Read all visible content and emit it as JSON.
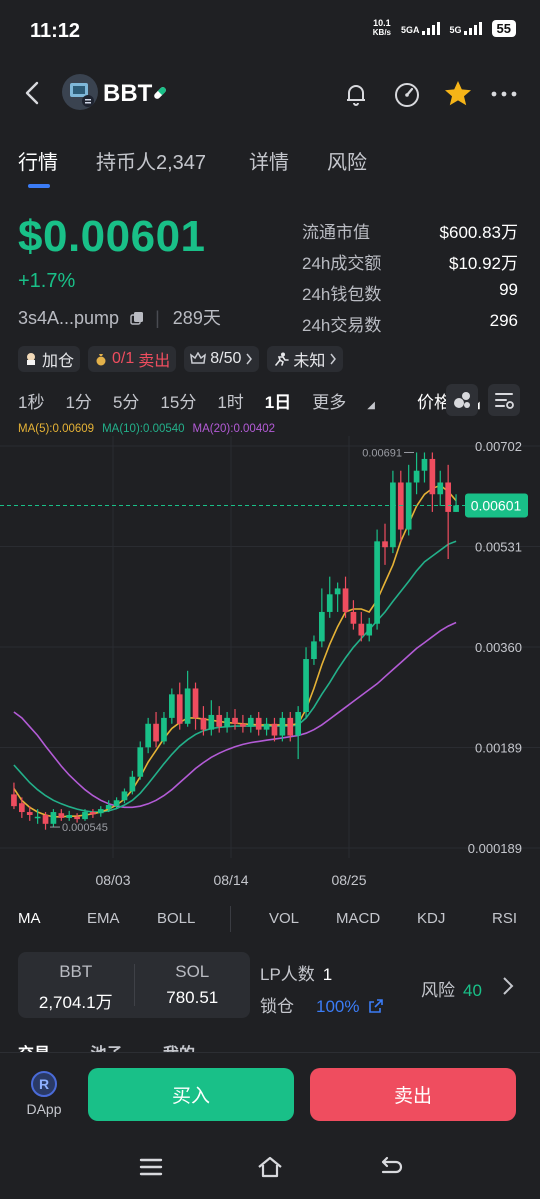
{
  "status": {
    "time": "11:12",
    "speed_value": "10.1",
    "speed_unit": "KB/s",
    "net1": "5GA",
    "net2": "5G",
    "battery": "55"
  },
  "header": {
    "token": "BBT",
    "icons": [
      "back-icon",
      "pill-icon",
      "bell-icon",
      "speedometer-icon",
      "star-icon",
      "more-icon"
    ]
  },
  "tabs": [
    {
      "label": "行情"
    },
    {
      "label": "持币人2,347"
    },
    {
      "label": "详情"
    },
    {
      "label": "风险"
    }
  ],
  "price": {
    "value": "$0.00601",
    "change": "+1.7%",
    "address": "3s4A...pump",
    "age": "289天"
  },
  "stats": [
    {
      "k": "流通市值",
      "v": "$600.83万"
    },
    {
      "k": "24h成交额",
      "v": "$10.92万"
    },
    {
      "k": "24h钱包数",
      "v": "99"
    },
    {
      "k": "24h交易数",
      "v": "296"
    }
  ],
  "tags": {
    "add": "加仓",
    "sell_count": "0/1",
    "sell": "卖出",
    "rank": "8/50",
    "unknown": "未知"
  },
  "intervals": [
    "1秒",
    "1分",
    "5分",
    "15分",
    "1时",
    "1日",
    "更多",
    "价格"
  ],
  "active_interval": "1日",
  "ma_legend": {
    "ma5": "MA(5):0.00609",
    "ma10": "MA(10):0.00540",
    "ma20": "MA(20):0.00402"
  },
  "colors": {
    "up": "#19c088",
    "down": "#ef4d5f",
    "ma5": "#e5b236",
    "ma10": "#23b08a",
    "ma20": "#b35bd6",
    "accent": "#3b7cf6"
  },
  "chart_data": {
    "type": "candlestick",
    "y_labels": [
      "0.00702",
      "0.00531",
      "0.00360",
      "0.00189",
      "0.000189"
    ],
    "x_labels": [
      "08/03",
      "08/14",
      "08/25"
    ],
    "current_price": "0.00601",
    "high_label": "0.00691",
    "low_label": "0.000545",
    "ylim": [
      0.000189,
      0.00702
    ],
    "candles": [
      [
        0.0011,
        0.0009,
        0.0013,
        0.00085
      ],
      [
        0.00095,
        0.0008,
        0.00105,
        0.0007
      ],
      [
        0.0008,
        0.00075,
        0.0009,
        0.00065
      ],
      [
        0.0007,
        0.00072,
        0.00085,
        0.0006
      ],
      [
        0.00075,
        0.0006,
        0.0008,
        0.0005
      ],
      [
        0.0006,
        0.0008,
        0.00085,
        0.000545
      ],
      [
        0.00078,
        0.0007,
        0.00085,
        0.00065
      ],
      [
        0.0007,
        0.00075,
        0.00082,
        0.00065
      ],
      [
        0.00072,
        0.00068,
        0.00078,
        0.00062
      ],
      [
        0.00068,
        0.0008,
        0.00085,
        0.00065
      ],
      [
        0.0008,
        0.00076,
        0.00085,
        0.0007
      ],
      [
        0.00078,
        0.00085,
        0.0009,
        0.00072
      ],
      [
        0.00085,
        0.00092,
        0.001,
        0.0008
      ],
      [
        0.0009,
        0.001,
        0.00105,
        0.00085
      ],
      [
        0.001,
        0.00115,
        0.0012,
        0.00095
      ],
      [
        0.00115,
        0.0014,
        0.0015,
        0.0011
      ],
      [
        0.0014,
        0.0019,
        0.002,
        0.00135
      ],
      [
        0.0019,
        0.0023,
        0.0024,
        0.0018
      ],
      [
        0.0023,
        0.002,
        0.0025,
        0.0019
      ],
      [
        0.002,
        0.0024,
        0.0025,
        0.00195
      ],
      [
        0.0024,
        0.0028,
        0.0029,
        0.0023
      ],
      [
        0.0028,
        0.0023,
        0.003,
        0.0022
      ],
      [
        0.0023,
        0.0029,
        0.0032,
        0.00225
      ],
      [
        0.0029,
        0.0024,
        0.003,
        0.0022
      ],
      [
        0.0024,
        0.0022,
        0.0026,
        0.0021
      ],
      [
        0.0022,
        0.00245,
        0.0027,
        0.0021
      ],
      [
        0.00245,
        0.00225,
        0.0026,
        0.00215
      ],
      [
        0.00225,
        0.0024,
        0.0025,
        0.00215
      ],
      [
        0.0024,
        0.0023,
        0.00255,
        0.0022
      ],
      [
        0.0023,
        0.00225,
        0.00245,
        0.00215
      ],
      [
        0.00225,
        0.0024,
        0.00245,
        0.00215
      ],
      [
        0.0024,
        0.0022,
        0.0025,
        0.0021
      ],
      [
        0.0022,
        0.0023,
        0.0024,
        0.0021
      ],
      [
        0.0023,
        0.0021,
        0.0024,
        0.002
      ],
      [
        0.0021,
        0.0024,
        0.0025,
        0.002
      ],
      [
        0.0024,
        0.0021,
        0.0025,
        0.002
      ],
      [
        0.0021,
        0.0025,
        0.0026,
        0.0017
      ],
      [
        0.0025,
        0.0034,
        0.0036,
        0.0024
      ],
      [
        0.0034,
        0.0037,
        0.0038,
        0.0033
      ],
      [
        0.0037,
        0.0042,
        0.0046,
        0.0036
      ],
      [
        0.0042,
        0.0045,
        0.0048,
        0.0041
      ],
      [
        0.0045,
        0.0046,
        0.0047,
        0.0042
      ],
      [
        0.0046,
        0.0042,
        0.0048,
        0.0041
      ],
      [
        0.0042,
        0.004,
        0.0044,
        0.0039
      ],
      [
        0.004,
        0.0038,
        0.0042,
        0.0037
      ],
      [
        0.0038,
        0.004,
        0.0041,
        0.0037
      ],
      [
        0.004,
        0.0054,
        0.0056,
        0.0039
      ],
      [
        0.0054,
        0.0053,
        0.0057,
        0.005
      ],
      [
        0.0053,
        0.0064,
        0.0066,
        0.0052
      ],
      [
        0.0064,
        0.0056,
        0.0066,
        0.0054
      ],
      [
        0.0056,
        0.0064,
        0.0067,
        0.0055
      ],
      [
        0.0064,
        0.0066,
        0.00691,
        0.0062
      ],
      [
        0.0066,
        0.0068,
        0.00691,
        0.0064
      ],
      [
        0.0068,
        0.0062,
        0.00691,
        0.0059
      ],
      [
        0.0062,
        0.0064,
        0.0066,
        0.006
      ],
      [
        0.0064,
        0.0059,
        0.0067,
        0.0051
      ],
      [
        0.0059,
        0.00601,
        0.0062,
        0.0059
      ]
    ],
    "ma5": [
      0.0012,
      0.001,
      0.00088,
      0.0008,
      0.00075,
      0.00072,
      0.00072,
      0.00073,
      0.00073,
      0.00075,
      0.00077,
      0.0008,
      0.00085,
      0.00092,
      0.00102,
      0.00118,
      0.0014,
      0.00165,
      0.00185,
      0.00205,
      0.00222,
      0.00232,
      0.0024,
      0.0024,
      0.00238,
      0.00236,
      0.00234,
      0.00232,
      0.00231,
      0.0023,
      0.00229,
      0.00228,
      0.00228,
      0.00228,
      0.00228,
      0.00228,
      0.0023,
      0.00255,
      0.0029,
      0.0033,
      0.00365,
      0.00395,
      0.0042,
      0.00425,
      0.00425,
      0.0042,
      0.0044,
      0.0047,
      0.005,
      0.0054,
      0.0057,
      0.006,
      0.0062,
      0.0063,
      0.00635,
      0.00625,
      0.00609
    ],
    "ma10": [
      0.0016,
      0.00145,
      0.0013,
      0.00118,
      0.00108,
      0.001,
      0.00094,
      0.00089,
      0.00085,
      0.00082,
      0.0008,
      0.0008,
      0.00082,
      0.00086,
      0.00092,
      0.001,
      0.00112,
      0.00128,
      0.00145,
      0.00162,
      0.00178,
      0.00192,
      0.00203,
      0.00212,
      0.00218,
      0.00222,
      0.00224,
      0.00225,
      0.00226,
      0.00226,
      0.00226,
      0.00226,
      0.00226,
      0.00226,
      0.00226,
      0.00226,
      0.00228,
      0.0024,
      0.00258,
      0.0028,
      0.003,
      0.00322,
      0.00342,
      0.0036,
      0.00375,
      0.0039,
      0.00405,
      0.0042,
      0.00438,
      0.00455,
      0.00472,
      0.0049,
      0.00505,
      0.00515,
      0.00525,
      0.00535,
      0.0054
    ],
    "ma20": [
      0.0025,
      0.0024,
      0.00225,
      0.0021,
      0.00192,
      0.00175,
      0.00158,
      0.00143,
      0.0013,
      0.00118,
      0.00108,
      0.001,
      0.00094,
      0.0009,
      0.00088,
      0.00088,
      0.0009,
      0.00094,
      0.001,
      0.00108,
      0.00118,
      0.0013,
      0.00142,
      0.00154,
      0.00164,
      0.00173,
      0.0018,
      0.00186,
      0.00191,
      0.00195,
      0.00198,
      0.002,
      0.00202,
      0.00204,
      0.00206,
      0.00208,
      0.0021,
      0.00214,
      0.0022,
      0.00228,
      0.00238,
      0.00248,
      0.00258,
      0.00268,
      0.00278,
      0.00288,
      0.00298,
      0.0031,
      0.00322,
      0.00334,
      0.00346,
      0.00358,
      0.00368,
      0.00378,
      0.00388,
      0.00396,
      0.00402
    ]
  },
  "indicators": [
    "MA",
    "EMA",
    "BOLL",
    "VOL",
    "MACD",
    "KDJ",
    "RSI"
  ],
  "pool": {
    "token_label": "BBT",
    "token_value": "2,704.1万",
    "sol_label": "SOL",
    "sol_value": "780.51"
  },
  "lp": {
    "label": "LP人数",
    "value": "1",
    "lock_label": "锁仓",
    "lock_value": "100%"
  },
  "risk": {
    "label": "风险",
    "value": "40"
  },
  "subtabs": [
    "交易",
    "池子",
    "我的"
  ],
  "bottom": {
    "dapp": "DApp",
    "buy": "买入",
    "sell": "卖出"
  }
}
